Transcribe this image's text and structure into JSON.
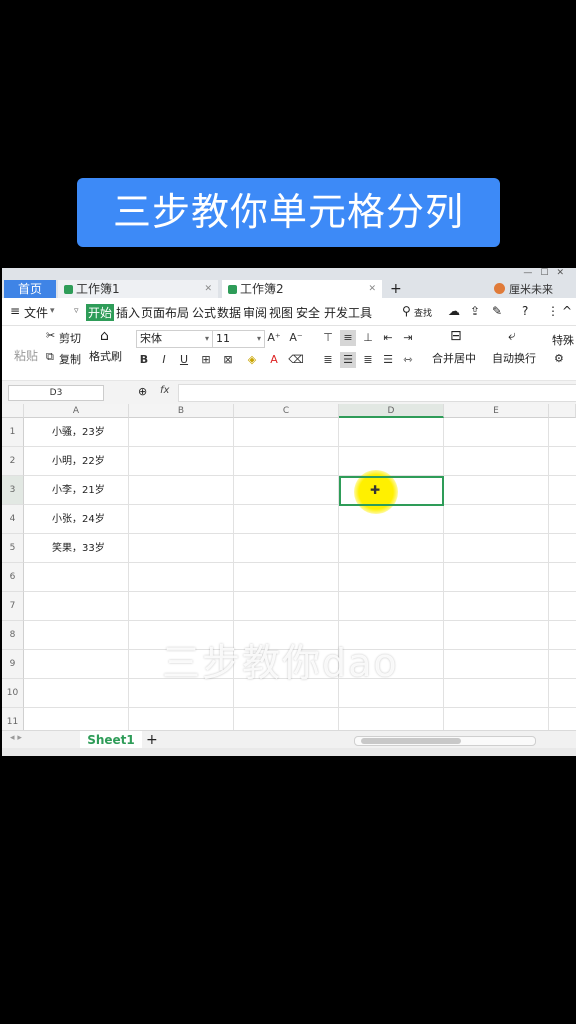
{
  "banner": {
    "title": "三步教你单元格分列"
  },
  "watermark": "三步教你dao",
  "tabs": {
    "home": "首页",
    "workbook1": "工作簿1",
    "workbook2": "工作簿2",
    "add": "+",
    "user": "厘米未来"
  },
  "menu": {
    "file": "文件",
    "items": [
      "开始",
      "插入",
      "页面布局",
      "公式",
      "数据",
      "审阅",
      "视图",
      "安全",
      "开发工具"
    ],
    "search": "查找",
    "help": "?"
  },
  "ribbon": {
    "cut": "剪切",
    "paste": "粘贴",
    "copy": "复制",
    "format_painter": "格式刷",
    "font_name": "宋体",
    "font_size": "11",
    "merge_center": "合并居中",
    "wrap_text": "自动换行",
    "special": "特殊"
  },
  "formula_bar": {
    "name_box": "D3",
    "fx": "fx"
  },
  "columns": [
    "A",
    "B",
    "C",
    "D",
    "E"
  ],
  "active_column": "D",
  "rows": [
    "1",
    "2",
    "3",
    "4",
    "5",
    "6",
    "7",
    "8",
    "9",
    "10",
    "11"
  ],
  "active_row": "3",
  "cells": {
    "A1": "小骚，23岁",
    "A2": "小明，22岁",
    "A3": "小李，21岁",
    "A4": "小张，24岁",
    "A5": "笑果，33岁"
  },
  "sheet": {
    "name": "Sheet1",
    "add": "+"
  },
  "colors": {
    "accent": "#2e9c58",
    "banner": "#3d8af7",
    "home_tab": "#3f84e6",
    "highlight": "#fff000"
  }
}
